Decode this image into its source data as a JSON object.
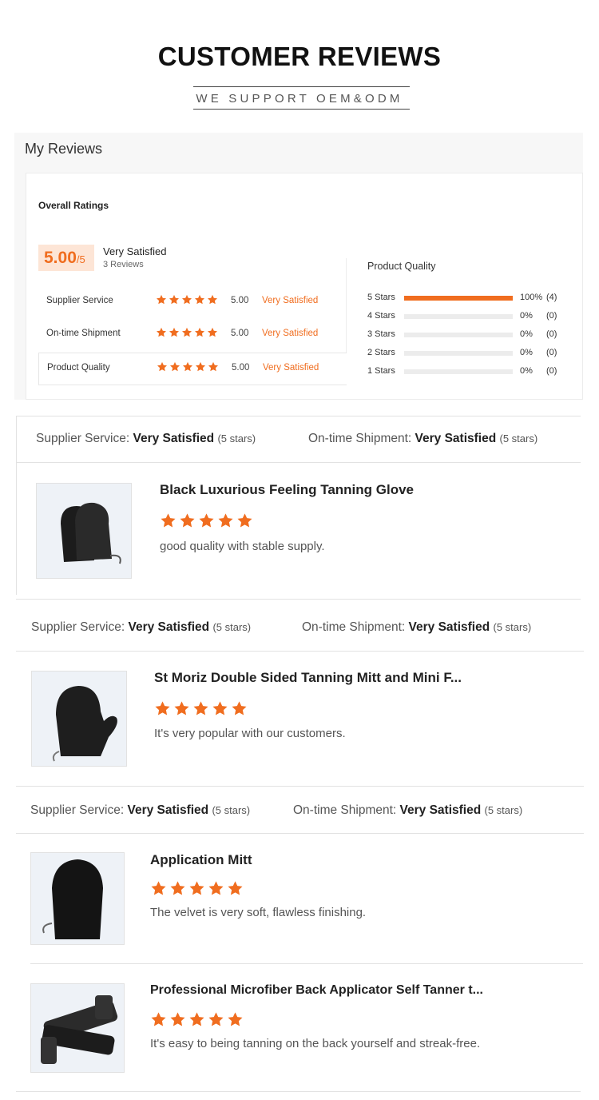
{
  "header": {
    "title": "CUSTOMER REVIEWS",
    "subtitle": "WE SUPPORT OEM&ODM"
  },
  "colors": {
    "accent": "#f06d1f",
    "score_bg": "#fde5d6",
    "panel_bg": "#f7f7f7"
  },
  "summary": {
    "title": "My Reviews",
    "overall_label": "Overall Ratings",
    "score": "5.00",
    "score_max": "/5",
    "score_text": "Very Satisfied",
    "review_count": "3 Reviews",
    "criteria": [
      {
        "label": "Supplier Service",
        "stars": 5,
        "value": "5.00",
        "text": "Very Satisfied"
      },
      {
        "label": "On-time Shipment",
        "stars": 5,
        "value": "5.00",
        "text": "Very Satisfied"
      },
      {
        "label": "Product Quality",
        "stars": 5,
        "value": "5.00",
        "text": "Very Satisfied"
      }
    ],
    "breakdown_title": "Product Quality",
    "breakdown": [
      {
        "label": "5 Stars",
        "fraction": 1.0,
        "percent": "100%",
        "count": "(4)"
      },
      {
        "label": "4 Stars",
        "fraction": 0,
        "percent": "0%",
        "count": "(0)"
      },
      {
        "label": "3 Stars",
        "fraction": 0,
        "percent": "0%",
        "count": "(0)"
      },
      {
        "label": "2 Stars",
        "fraction": 0,
        "percent": "0%",
        "count": "(0)"
      },
      {
        "label": "1 Stars",
        "fraction": 0,
        "percent": "0%",
        "count": "(0)"
      }
    ]
  },
  "reviews": [
    {
      "supplier_label": "Supplier Service:",
      "supplier_value": "Very Satisfied",
      "supplier_stars": "(5 stars)",
      "shipment_label": "On-time Shipment:",
      "shipment_value": "Very Satisfied",
      "shipment_stars": "(5 stars)",
      "product": "Black Luxurious Feeling Tanning Glove",
      "rating": 5,
      "comment": "good quality with stable supply.",
      "image_icon": "tanning-glove-icon"
    },
    {
      "supplier_label": "Supplier Service:",
      "supplier_value": "Very Satisfied",
      "supplier_stars": "(5 stars)",
      "shipment_label": "On-time Shipment:",
      "shipment_value": "Very Satisfied",
      "shipment_stars": "(5 stars)",
      "product": "St Moriz Double Sided Tanning Mitt and Mini F...",
      "rating": 5,
      "comment": "It's very popular with our customers.",
      "image_icon": "tanning-mitt-thumb-icon"
    },
    {
      "supplier_label": "Supplier Service:",
      "supplier_value": "Very Satisfied",
      "supplier_stars": "(5 stars)",
      "shipment_label": "On-time Shipment:",
      "shipment_value": "Very Satisfied",
      "shipment_stars": "(5 stars)",
      "product": "Application Mitt",
      "rating": 5,
      "comment": "The velvet is very soft, flawless finishing.",
      "image_icon": "application-mitt-icon"
    },
    {
      "product": "Professional Microfiber Back Applicator Self Tanner t...",
      "rating": 5,
      "comment": "It's easy to being tanning on the back yourself and streak-free.",
      "image_icon": "back-applicator-icon"
    }
  ]
}
